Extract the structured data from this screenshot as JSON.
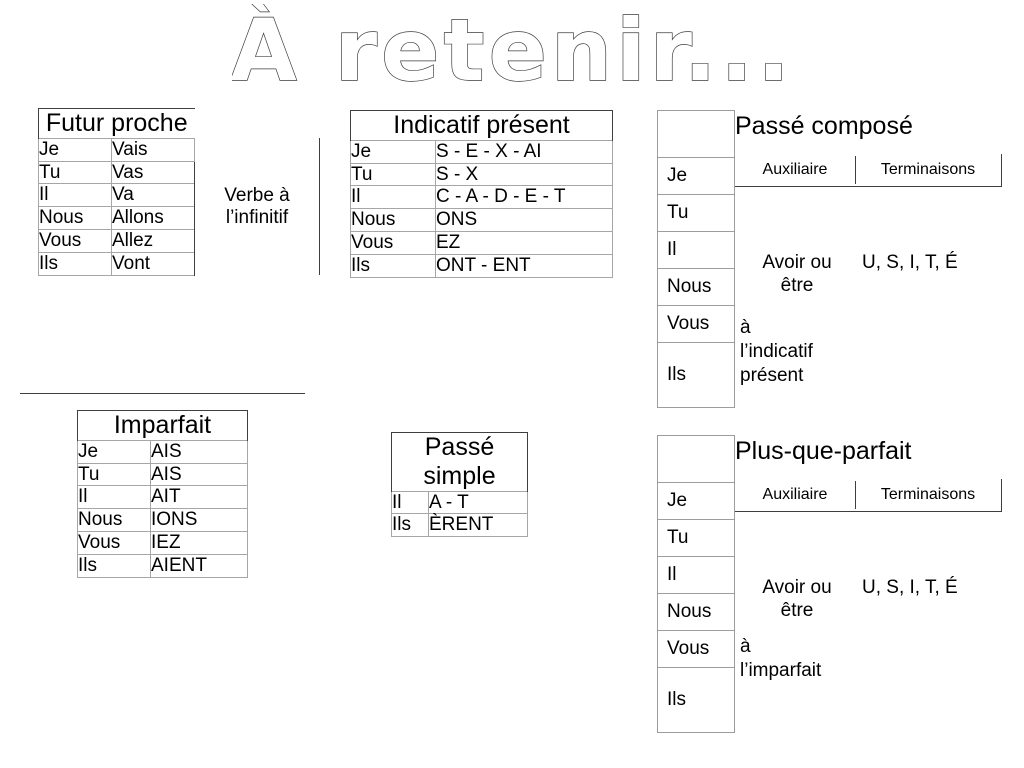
{
  "slide": {
    "title": "À retenir..."
  },
  "tables": {
    "futur_proche": {
      "title": "Futur proche",
      "rows": [
        {
          "pronoun": "Je",
          "form": "Vais"
        },
        {
          "pronoun": "Tu",
          "form": "Vas"
        },
        {
          "pronoun": "Il",
          "form": "Va"
        },
        {
          "pronoun": "Nous",
          "form": "Allons"
        },
        {
          "pronoun": "Vous",
          "form": "Allez"
        },
        {
          "pronoun": "Ils",
          "form": "Vont"
        }
      ],
      "note": "Verbe à\nl’infinitif"
    },
    "indicatif_present": {
      "title": "Indicatif présent",
      "rows": [
        {
          "pronoun": "Je",
          "form": "S - E - X - AI"
        },
        {
          "pronoun": "Tu",
          "form": "S - X"
        },
        {
          "pronoun": "Il",
          "form": "C - A - D - E - T"
        },
        {
          "pronoun": "Nous",
          "form": "ONS"
        },
        {
          "pronoun": "Vous",
          "form": "EZ"
        },
        {
          "pronoun": "Ils",
          "form": "ONT - ENT"
        }
      ]
    },
    "imparfait": {
      "title": "Imparfait",
      "rows": [
        {
          "pronoun": "Je",
          "form": "AIS"
        },
        {
          "pronoun": "Tu",
          "form": "AIS"
        },
        {
          "pronoun": "Il",
          "form": "AIT"
        },
        {
          "pronoun": "Nous",
          "form": "IONS"
        },
        {
          "pronoun": "Vous",
          "form": "IEZ"
        },
        {
          "pronoun": "Ils",
          "form": "AIENT"
        }
      ]
    },
    "passe_simple": {
      "title": "Passé\nsimple",
      "rows": [
        {
          "pronoun": "Il",
          "form": "A - T"
        },
        {
          "pronoun": "Ils",
          "form": "ÈRENT"
        }
      ]
    },
    "passe_compose": {
      "title": "Passé composé",
      "header": {
        "auxiliaire": "Auxiliaire",
        "terminaisons": "Terminaisons"
      },
      "pronouns": [
        "Je",
        "Tu",
        "Il",
        "Nous",
        "Vous",
        "Ils"
      ],
      "auxiliaire": "Avoir ou\nêtre",
      "auxiliaire_note": "à\nl’indicatif\nprésent",
      "terminaisons": "U, S, I, T, É"
    },
    "plus_que_parfait": {
      "title": "Plus-que-parfait",
      "header": {
        "auxiliaire": "Auxiliaire",
        "terminaisons": "Terminaisons"
      },
      "pronouns": [
        "Je",
        "Tu",
        "Il",
        "Nous",
        "Vous",
        "Ils"
      ],
      "auxiliaire": "Avoir ou\nêtre",
      "auxiliaire_note": "à\nl’imparfait",
      "terminaisons": "U, S, I, T, É"
    }
  }
}
